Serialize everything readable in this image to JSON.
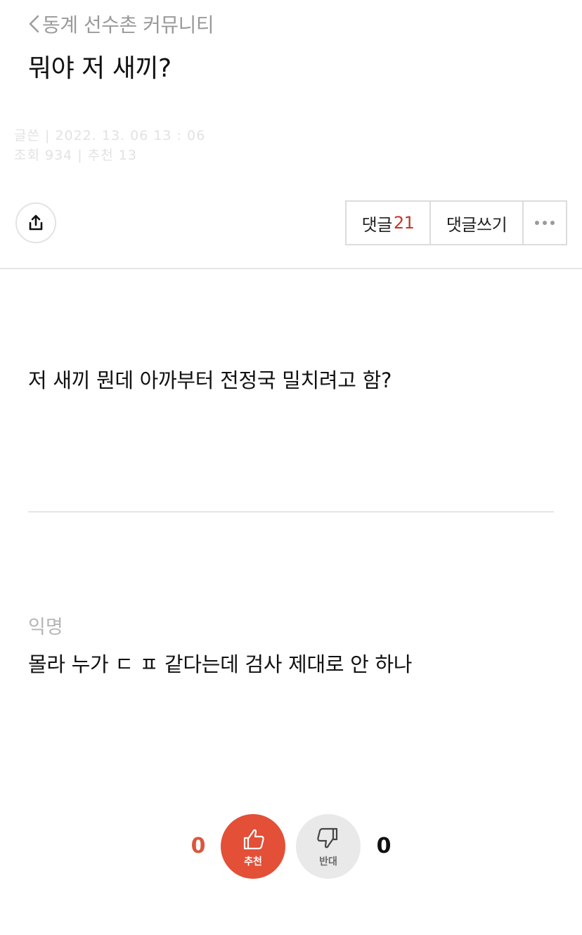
{
  "header": {
    "back_label": "동계 선수촌 커뮤니티",
    "title": "뭐야 저 새끼?"
  },
  "meta": {
    "line1": "글쓴  | 2022. 13. 06 13 : 06",
    "line2": "조회 934 | 추천 13"
  },
  "actions": {
    "comments_label": "댓글",
    "comments_count": "21",
    "write_comment_label": "댓글쓰기",
    "share_icon": "share-icon",
    "more_icon": "more-horizontal-icon"
  },
  "post": {
    "body": "저 새끼 뭔데 아까부터 전정국 밀치려고 함?"
  },
  "comment": {
    "author": "익명",
    "text": "몰라 누가 ㄷ ㅍ 같다는데 검사 제대로 안 하나"
  },
  "votes": {
    "up_count": "0",
    "up_label": "추천",
    "down_count": "0",
    "down_label": "반대"
  },
  "colors": {
    "accent": "#e34f37",
    "count_red": "#d9573e",
    "comment_count": "#c0392b"
  }
}
